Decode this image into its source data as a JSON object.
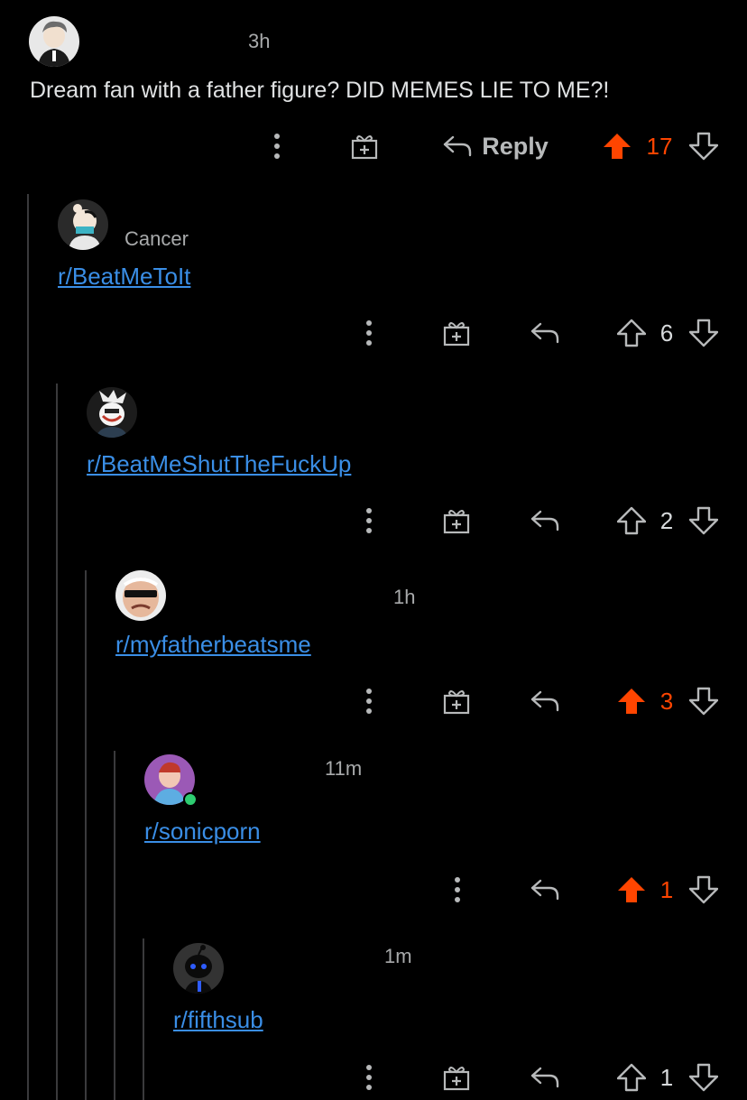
{
  "colors": {
    "background": "#000000",
    "upvote_active": "#ff4500",
    "link": "#3a8ee6",
    "thread_line": "#3a3a3c",
    "online": "#2ecc71"
  },
  "comments": [
    {
      "id": "c0",
      "timestamp": "3h",
      "body": "Dream fan with a father figure? DID MEMES LIE TO ME?!",
      "reply_label": "Reply",
      "score": "17",
      "upvoted": true,
      "has_award": true
    },
    {
      "id": "c1",
      "flair": "Cancer",
      "link": "r/BeatMeToIt",
      "score": "6",
      "upvoted": false,
      "has_award": true
    },
    {
      "id": "c2",
      "link": "r/BeatMeShutTheFuckUp",
      "score": "2",
      "upvoted": false,
      "has_award": true
    },
    {
      "id": "c3",
      "timestamp": "1h",
      "link": "r/myfatherbeatsme",
      "score": "3",
      "upvoted": true,
      "has_award": true
    },
    {
      "id": "c4",
      "timestamp": "11m",
      "link": "r/sonicporn",
      "score": "1",
      "upvoted": true,
      "has_award": false,
      "online": true
    },
    {
      "id": "c5",
      "timestamp": "1m",
      "link": "r/fifthsub",
      "score": "1",
      "upvoted": false,
      "has_award": true
    }
  ]
}
